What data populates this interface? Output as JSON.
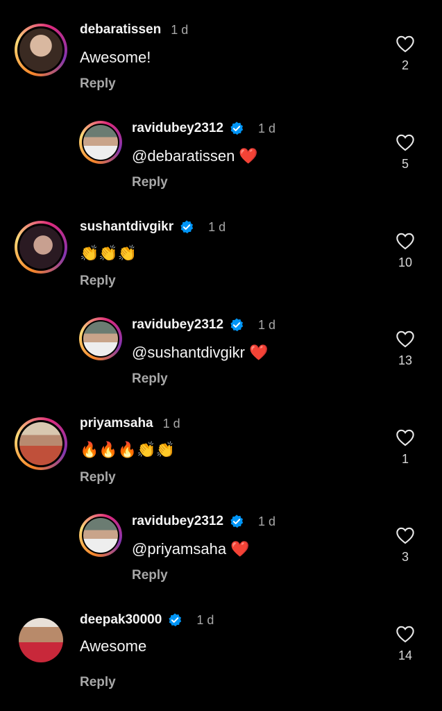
{
  "comments": [
    {
      "username": "debaratissen",
      "time": "1 d",
      "text": "Awesome!",
      "reply": "Reply",
      "likes": "2"
    },
    {
      "username": "ravidubey2312",
      "time": "1 d",
      "text": "@debaratissen ❤️",
      "reply": "Reply",
      "likes": "5"
    },
    {
      "username": "sushantdivgikr",
      "time": "1 d",
      "text": "👏👏👏",
      "reply": "Reply",
      "likes": "10"
    },
    {
      "username": "ravidubey2312",
      "time": "1 d",
      "text": "@sushantdivgikr ❤️",
      "reply": "Reply",
      "likes": "13"
    },
    {
      "username": "priyamsaha",
      "time": "1 d",
      "text": "🔥🔥🔥👏👏",
      "reply": "Reply",
      "likes": "1"
    },
    {
      "username": "ravidubey2312",
      "time": "1 d",
      "text": "@priyamsaha ❤️",
      "reply": "Reply",
      "likes": "3"
    },
    {
      "username": "deepak30000",
      "time": "1 d",
      "text": "Awesome",
      "reply": "Reply",
      "likes": "14"
    }
  ],
  "colors": {
    "background": "#000000",
    "verified_badge": "#0095f6",
    "secondary_text": "#a8a8a8",
    "heart_red": "#e0132a"
  },
  "icons": {
    "like": "heart-outline-icon",
    "verified": "verified-badge-icon"
  }
}
